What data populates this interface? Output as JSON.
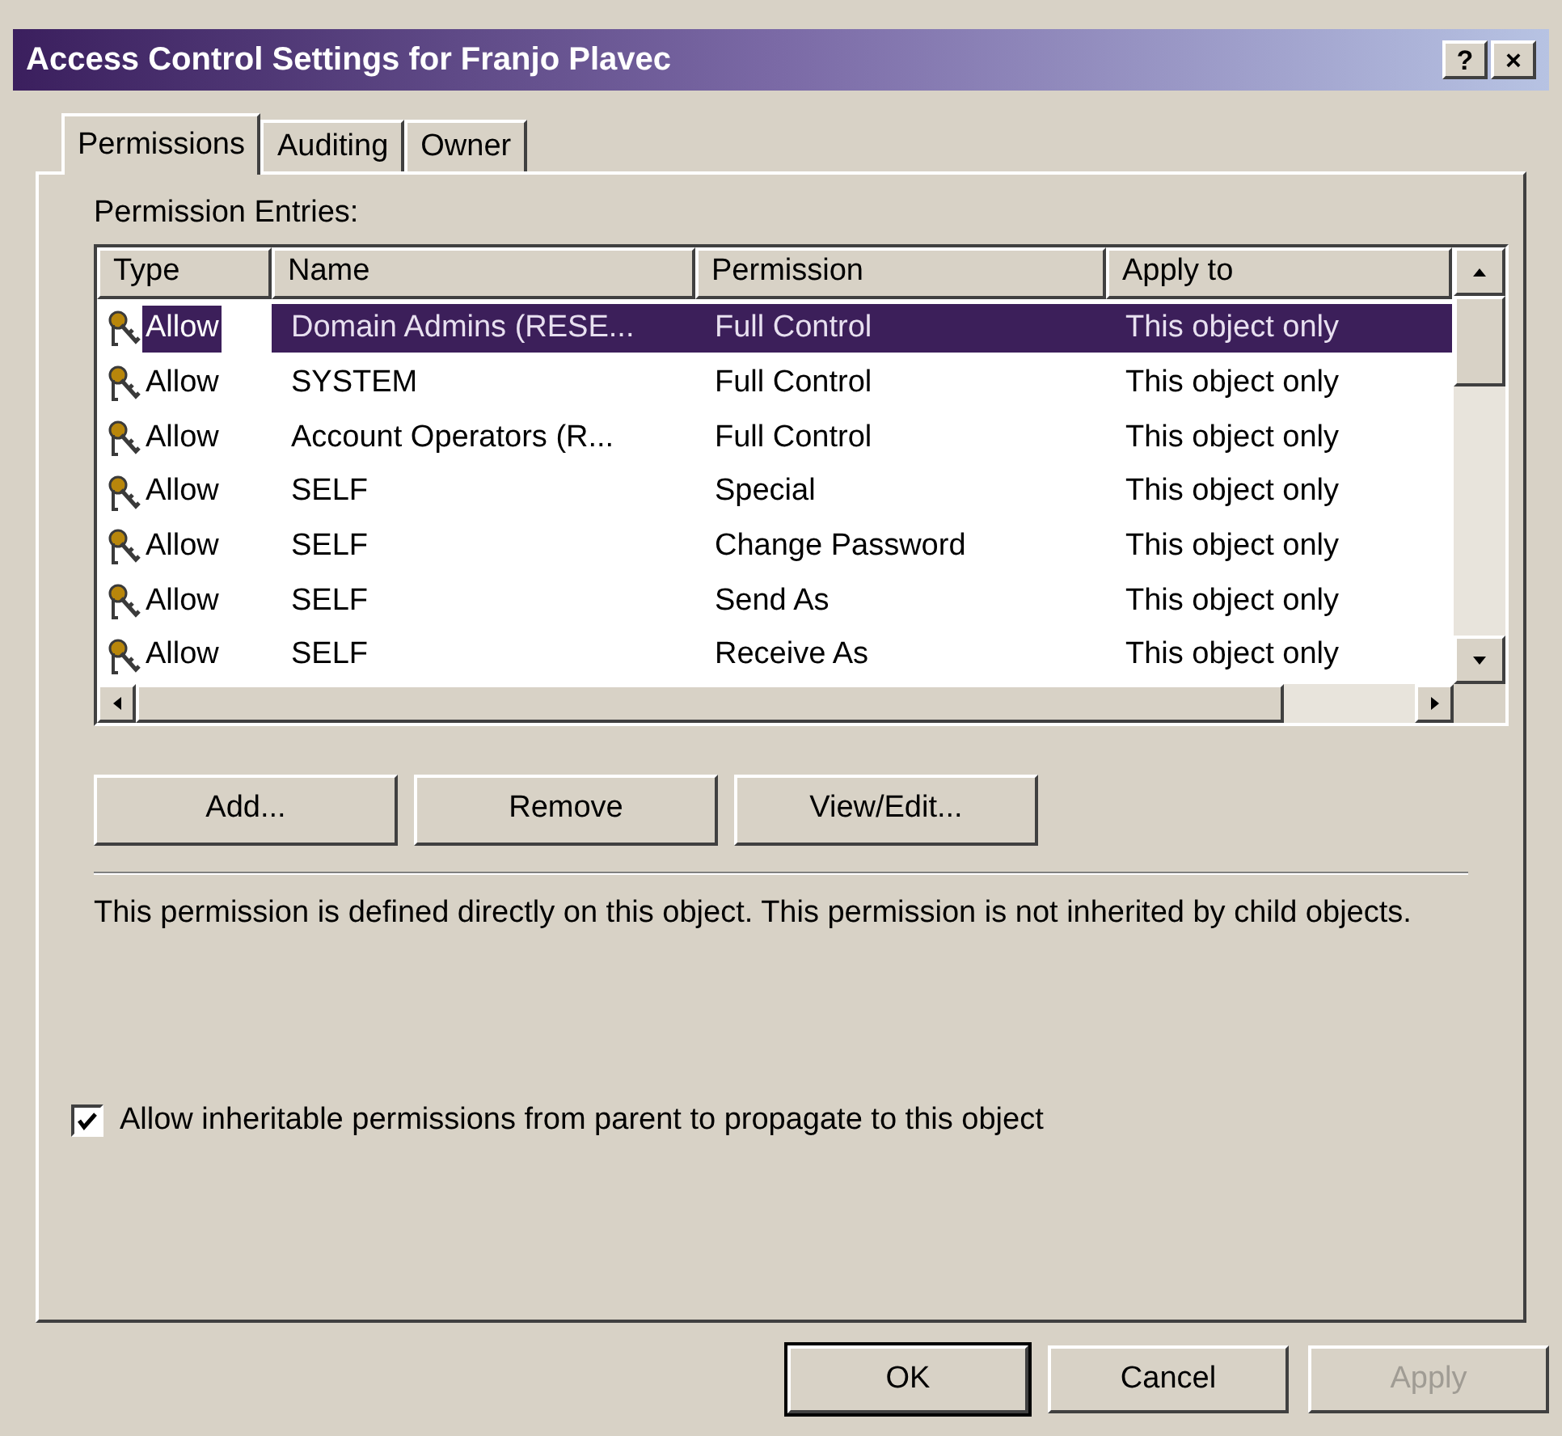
{
  "window": {
    "title": "Access Control Settings for Franjo Plavec",
    "title_buttons": [
      "?",
      "×"
    ]
  },
  "tabs": [
    {
      "label": "Permissions",
      "selected": true
    },
    {
      "label": "Auditing",
      "selected": false
    },
    {
      "label": "Owner",
      "selected": false
    }
  ],
  "list_label": "Permission Entries:",
  "table": {
    "columns": [
      "Type",
      "Name",
      "Permission",
      "Apply to"
    ],
    "rows": [
      {
        "type": "Allow",
        "name": "Domain Admins (RESE...",
        "permission": "Full Control",
        "apply_to": "This object only",
        "selected": true
      },
      {
        "type": "Allow",
        "name": "SYSTEM",
        "permission": "Full Control",
        "apply_to": "This object only",
        "selected": false
      },
      {
        "type": "Allow",
        "name": "Account Operators (R...",
        "permission": "Full Control",
        "apply_to": "This object only",
        "selected": false
      },
      {
        "type": "Allow",
        "name": "SELF",
        "permission": "Special",
        "apply_to": "This object only",
        "selected": false
      },
      {
        "type": "Allow",
        "name": "SELF",
        "permission": "Change Password",
        "apply_to": "This object only",
        "selected": false
      },
      {
        "type": "Allow",
        "name": "SELF",
        "permission": "Send As",
        "apply_to": "This object only",
        "selected": false
      },
      {
        "type": "Allow",
        "name": "SELF",
        "permission": "Receive As",
        "apply_to": "This object only",
        "selected": false
      }
    ]
  },
  "entry_buttons": [
    {
      "label": "Add...",
      "disabled": false
    },
    {
      "label": "Remove",
      "disabled": false
    },
    {
      "label": "View/Edit...",
      "disabled": false
    }
  ],
  "description": "This permission is defined directly on this object. This permission is not inherited by child objects.",
  "inherit_checkbox": {
    "label": "Allow inheritable permissions from parent to propagate to this object",
    "checked": true
  },
  "dialog_buttons": [
    {
      "label": "OK",
      "disabled": false,
      "default": true
    },
    {
      "label": "Cancel",
      "disabled": false,
      "default": false
    },
    {
      "label": "Apply",
      "disabled": true,
      "default": false
    }
  ]
}
